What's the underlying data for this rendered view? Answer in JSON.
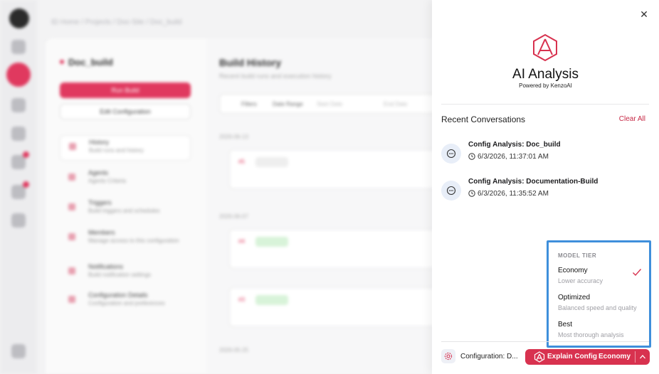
{
  "background": {
    "breadcrumb": "ID Home / Projects / Doc-Site / Doc_build",
    "config_name": "Doc_build",
    "run_button": "Run Build",
    "edit_button": "Edit Configuration",
    "nav": [
      {
        "label": "History",
        "sub": "Build runs and history"
      },
      {
        "label": "Agents",
        "sub": "Agents Criteria"
      },
      {
        "label": "Triggers",
        "sub": "Build triggers and schedules"
      },
      {
        "label": "Members",
        "sub": "Manage access to this configuration"
      },
      {
        "label": "Notifications",
        "sub": "Build notification settings"
      },
      {
        "label": "Configuration Details",
        "sub": "Configuration and preferences"
      }
    ],
    "main_title": "Build History",
    "main_sub": "Recent build runs and execution history",
    "filters_label": "Filters",
    "date_range_label": "Date Range",
    "start_placeholder": "Start Date",
    "end_placeholder": "End Date",
    "date_groups": [
      "2026-06-13",
      "2026-06-07",
      "2026-05-25"
    ]
  },
  "panel": {
    "title": "AI Analysis",
    "powered_by": "Powered by KenzoAI",
    "recent_heading": "Recent Conversations",
    "clear_all": "Clear All",
    "conversations": [
      {
        "title": "Config Analysis: Doc_build",
        "time": "6/3/2026, 11:37:01 AM"
      },
      {
        "title": "Config Analysis: Documentation-Build",
        "time": "6/3/2026, 11:35:52 AM"
      }
    ],
    "model_tier": {
      "heading": "MODEL TIER",
      "options": [
        {
          "name": "Economy",
          "desc": "Lower accuracy",
          "selected": true
        },
        {
          "name": "Optimized",
          "desc": "Balanced speed and quality",
          "selected": false
        },
        {
          "name": "Best",
          "desc": "Most thorough analysis",
          "selected": false
        }
      ]
    },
    "footer": {
      "config_label": "Configuration: D...",
      "explain_label": "Explain Config",
      "tier_label": "Economy"
    }
  },
  "colors": {
    "accent": "#d8324f",
    "highlight_border": "#3f8fdb"
  }
}
